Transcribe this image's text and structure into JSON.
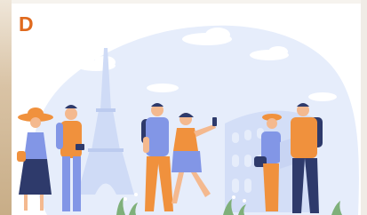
{
  "card": {
    "letter": "D"
  },
  "illustration": {
    "description_icons": [
      "eiffel-tower-icon",
      "colosseum-icon",
      "camera-icon",
      "smartphone-icon",
      "map-icon"
    ],
    "colors": {
      "sky_blob": "#e4ecfb",
      "landmark": "#d3def7",
      "cloud": "#ffffff",
      "orange": "#f0913d",
      "navy": "#2e3a6b",
      "periwinkle": "#8296e6",
      "skin": "#f4b98f",
      "grass": "#7fb07a"
    }
  }
}
